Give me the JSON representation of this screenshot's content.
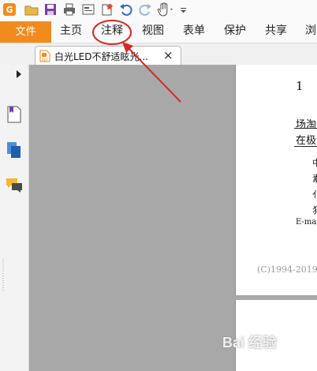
{
  "menu": {
    "file": "文件",
    "items": [
      {
        "label": "主页"
      },
      {
        "label": "注释"
      },
      {
        "label": "视图"
      },
      {
        "label": "表单"
      },
      {
        "label": "保护"
      },
      {
        "label": "共享"
      },
      {
        "label": "浏"
      }
    ]
  },
  "document_tab": {
    "title": "白光LED不舒适眩光...",
    "icon_label": "PDF",
    "close": "×"
  },
  "page": {
    "number": "1",
    "line1": "场淘",
    "line2": "在极",
    "chars": [
      "中",
      "素",
      "亻",
      "犭"
    ],
    "email": "E-mai",
    "copyright": "(C)1994-2019"
  },
  "watermark": "Bai 经验",
  "colors": {
    "file_tab": "#f28b1e",
    "annotation_circle": "#d62828",
    "viewport_bg": "#a8a8a8"
  }
}
